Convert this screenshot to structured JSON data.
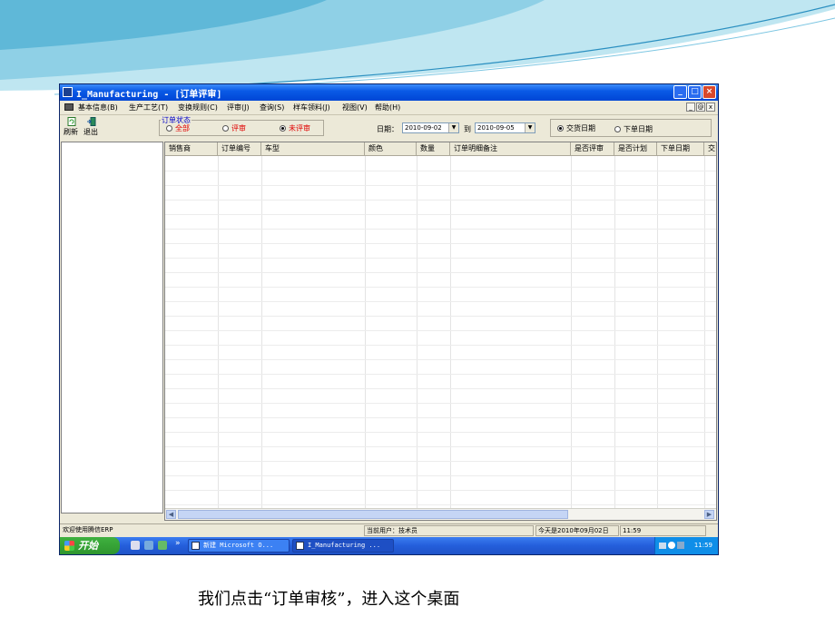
{
  "window": {
    "title": "I_Manufacturing - [订单评审]",
    "controls": [
      "_",
      "□",
      "×"
    ]
  },
  "menu": [
    "基本信息(B)",
    "生产工艺(T)",
    "变换规则(C)",
    "评审(J)",
    "查询(S)",
    "样车领料(J)",
    "视图(V)",
    "帮助(H)"
  ],
  "mdi_controls": [
    "_",
    "@",
    "x"
  ],
  "toolbar": {
    "refresh_label": "刷新",
    "exit_label": "退出"
  },
  "order_status": {
    "label": "订单状态",
    "options": [
      {
        "label": "全部",
        "selected": false
      },
      {
        "label": "评审",
        "selected": false
      },
      {
        "label": "未评审",
        "selected": true
      }
    ]
  },
  "date_filter": {
    "label": "日期：",
    "from": "2010-09-02",
    "to_label": "到",
    "to": "2010-09-05"
  },
  "date_type": {
    "options": [
      {
        "label": "交货日期",
        "selected": true
      },
      {
        "label": "下单日期",
        "selected": false
      }
    ]
  },
  "grid": {
    "columns": [
      "销售商",
      "订单编号",
      "车型",
      "颜色",
      "数量",
      "订单明细备注",
      "是否评审",
      "是否计划",
      "下单日期",
      "交"
    ]
  },
  "status": {
    "welcome": "欢迎使用腾信ERP",
    "user": "当前用户：技术员",
    "date": "今天是2010年09月02日",
    "time": "11:59"
  },
  "taskbar": {
    "start_label": "开始",
    "quick_more": "»",
    "tasks": [
      "新建 Microsoft O...",
      "I_Manufacturing ..."
    ],
    "clock": "11:59"
  },
  "caption": "我们点击“订单审核”，进入这个桌面",
  "colors": {
    "title_blue": "#0046d5",
    "taskbar_blue": "#245edb",
    "start_green": "#2e952e",
    "status_red": "#e00000"
  }
}
